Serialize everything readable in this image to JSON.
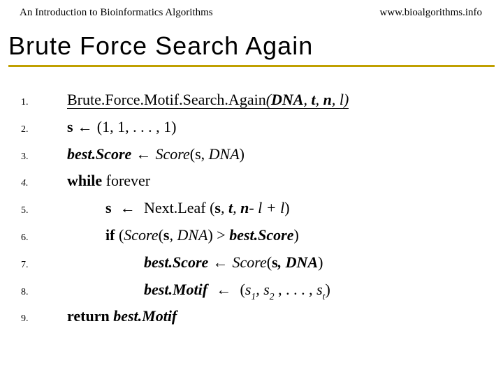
{
  "header": {
    "left": "An Introduction to Bioinformatics Algorithms",
    "right": "www.bioalgorithms.info"
  },
  "title": "Brute Force Search Again",
  "code": {
    "l1": {
      "fn": "Brute.Force.Motif.Search.Again",
      "args_open": "(",
      "a1": "DNA",
      "sep1": ", ",
      "a2": "t",
      "sep2": ", ",
      "a3": "n",
      "sep3": ", ",
      "a4": "l",
      "args_close": ")"
    },
    "l2": {
      "s": "s",
      "arrow": " ← ",
      "rest": "(1, 1, . . . , 1)"
    },
    "l3": {
      "lhs": "best.Score",
      "arrow": " ← ",
      "rhs_fn": "Score",
      "rhs_open": "(s, ",
      "rhs_dna": "DNA",
      "rhs_close": ")"
    },
    "l4": {
      "kw": "while",
      "rest": " forever"
    },
    "l5": {
      "indent": "          ",
      "s": "s",
      "arrow": "  ←  ",
      "fn": "Next.Leaf ",
      "open": "(",
      "a1": "s",
      "sep1": ", ",
      "a2": "t",
      "sep2": ", ",
      "a3pre": "n",
      "a3mid": "- l + l",
      "close": ")"
    },
    "l6": {
      "indent": "          ",
      "kw": "if",
      "open": " (",
      "fn": "Score",
      "popen": "(",
      "a1": "s",
      "sep1": ", ",
      "a2": "DNA",
      "pclose": ")",
      "gt": " > ",
      "rhs": "best.Score",
      "close": ")"
    },
    "l7": {
      "indent": "                    ",
      "lhs": "best.Score",
      "arrow": " ← ",
      "fn": "Score",
      "open": "(",
      "a1": "s",
      "sep1": ", ",
      "a2": "DNA",
      "close": ")"
    },
    "l8": {
      "indent": "                    ",
      "lhs": "best.Motif",
      "arrow": "  ←  ",
      "open": "(",
      "s": "s",
      "sub1": "1",
      "sep1": ", ",
      "s2": "s",
      "sub2": "2",
      "mid": " , . . . , ",
      "st": "s",
      "subt": "t",
      "close": ")"
    },
    "l9": {
      "kw": "return",
      "sp": " ",
      "val": "best.Motif"
    }
  },
  "nums": {
    "n1": "1.",
    "n2": "2.",
    "n3": "3.",
    "n4": "4.",
    "n5": "5.",
    "n6": "6.",
    "n7": "7.",
    "n8": "8.",
    "n9": "9."
  }
}
